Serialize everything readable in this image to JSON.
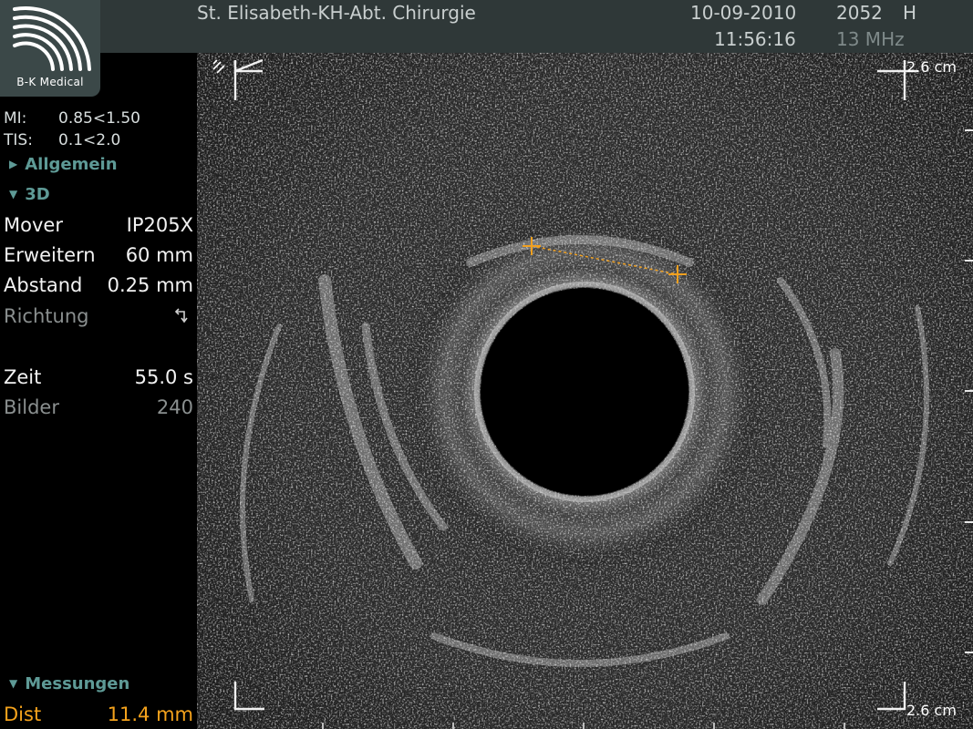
{
  "header": {
    "logo": "B-K Medical",
    "hospital": "St. Elisabeth-KH-Abt. Chirurgie",
    "date": "10-09-2010",
    "time": "11:56:16",
    "frame_no": "2052",
    "orientation": "H",
    "frequency": "13 MHz"
  },
  "indices": {
    "mi_label": "MI:",
    "mi_value": "0.85<1.50",
    "tis_label": "TIS:",
    "tis_value": "0.1<2.0"
  },
  "panel": {
    "section_general": "Allgemein",
    "section_3d": "3D",
    "rows": [
      {
        "label": "Mover",
        "value": "IP205X"
      },
      {
        "label": "Erweitern",
        "value": "60 mm"
      },
      {
        "label": "Abstand",
        "value": "0.25 mm"
      },
      {
        "label": "Richtung",
        "value": ""
      },
      {
        "label": "Zeit",
        "value": "55.0 s"
      },
      {
        "label": "Bilder",
        "value": "240"
      }
    ],
    "section_measurements": "Messungen",
    "measurement": {
      "label": "Dist",
      "value": "11.4 mm"
    }
  },
  "image": {
    "scale_top": "2.6 cm",
    "scale_bottom": "2.6 cm",
    "measure_color": "#f0a020"
  }
}
